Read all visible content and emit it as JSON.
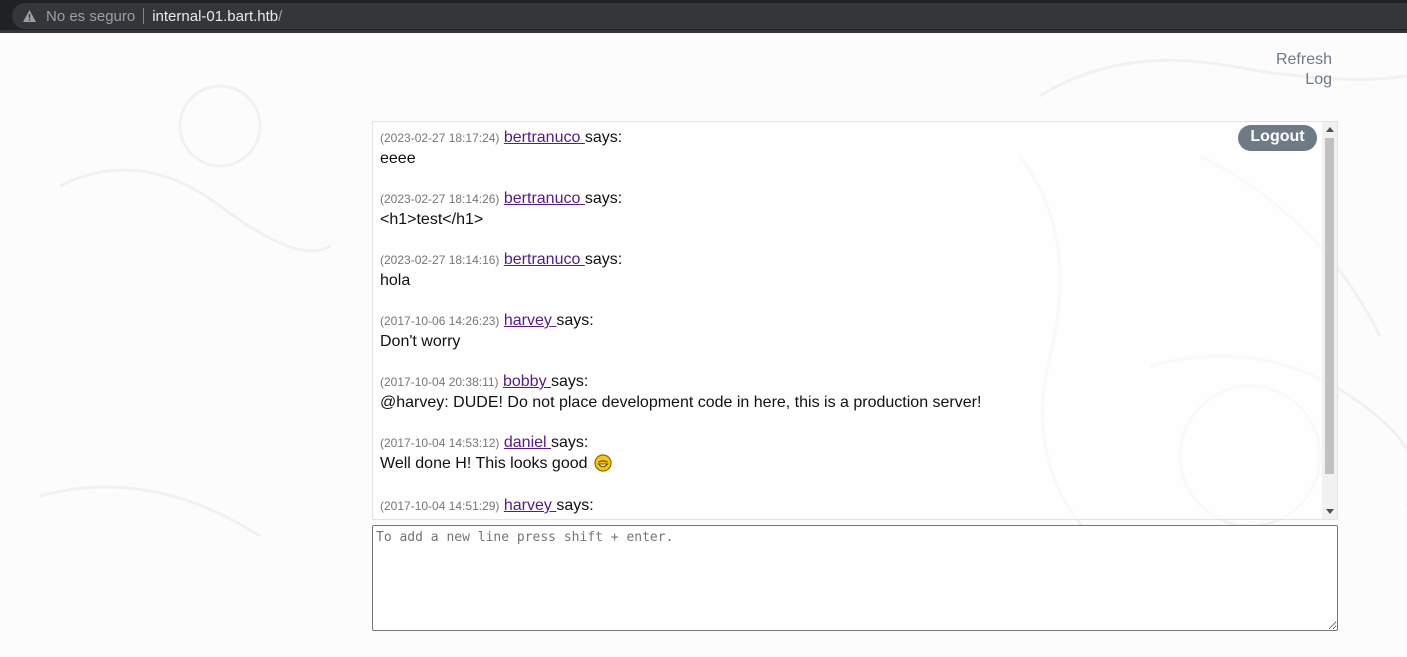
{
  "browser": {
    "security_label": "No es seguro",
    "host": "internal-01.bart.htb",
    "path": "/"
  },
  "top_links": {
    "refresh": "Refresh",
    "log": "Log"
  },
  "chat": {
    "logout_label": "Logout",
    "says": "says:",
    "messages": [
      {
        "timestamp": "(2023-02-27 18:17:24)",
        "user": "bertranuco ",
        "text": "eeee"
      },
      {
        "timestamp": "(2023-02-27 18:14:26)",
        "user": "bertranuco ",
        "text": "<h1>test</h1>"
      },
      {
        "timestamp": "(2023-02-27 18:14:16)",
        "user": "bertranuco ",
        "text": "hola"
      },
      {
        "timestamp": "(2017-10-06 14:26:23)",
        "user": "harvey ",
        "text": "Don't worry"
      },
      {
        "timestamp": "(2017-10-04 20:38:11)",
        "user": "bobby ",
        "text": "@harvey: DUDE! Do not place development code in here, this is a production server!"
      },
      {
        "timestamp": "(2017-10-04 14:53:12)",
        "user": "daniel ",
        "text": "Well done H! This looks good "
      },
      {
        "timestamp": "(2017-10-04 14:51:29)",
        "user": "harvey ",
        "text": ""
      }
    ],
    "input_placeholder": "To add a new line press shift + enter."
  },
  "icons": {
    "warning": "warning-icon",
    "smiley": "smiley-emoji-icon"
  },
  "colors": {
    "link": "#551a8b",
    "logout_bg": "#6f7a87",
    "toplink": "#6c7a8c"
  }
}
